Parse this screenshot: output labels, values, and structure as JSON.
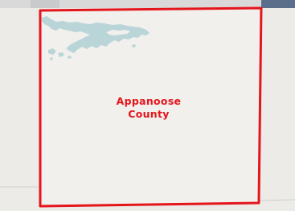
{
  "map": {
    "county": {
      "name_line1": "Appanoose",
      "name_line2": "County",
      "boundary_color": "#e4151b"
    },
    "colors": {
      "background": "#f2f1ee",
      "neighbor_background": "#ecebe8",
      "water": "#b9d5d8",
      "top_strip_blue": "#5b6f8a",
      "top_strip_gray": "#c9cacb"
    },
    "features": [
      "county-boundary",
      "lake-water-body"
    ]
  }
}
